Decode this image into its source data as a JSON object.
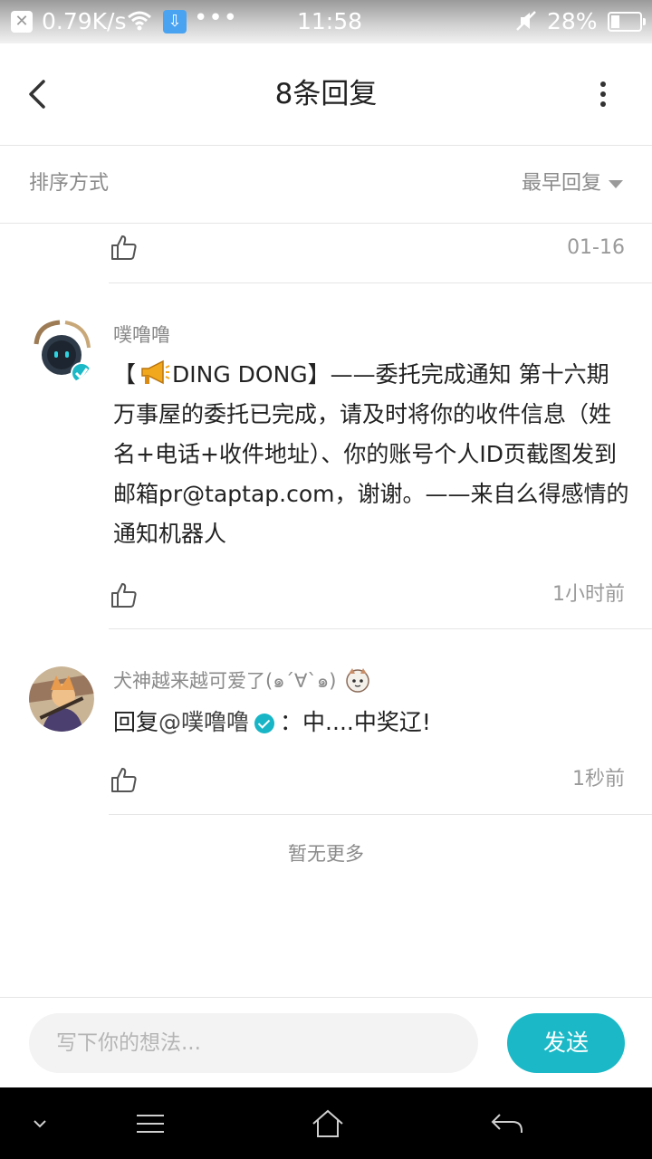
{
  "status_bar": {
    "network_speed": "0.79K/s",
    "time": "11:58",
    "battery": "28%",
    "icons": [
      "close-notification-icon",
      "wifi-icon",
      "app-download-icon",
      "more-notifications-icon",
      "mute-icon",
      "battery-icon"
    ]
  },
  "header": {
    "title": "8条回复",
    "back_icon": "back-arrow-icon",
    "menu_icon": "more-vertical-icon"
  },
  "sort": {
    "label": "排序方式",
    "selected": "最早回复"
  },
  "replies": [
    {
      "time": "01-16"
    },
    {
      "username": "噗噜噜",
      "verified": true,
      "body_prefix": "【",
      "body_icon": "megaphone-icon",
      "body": "DING DONG】——委托完成通知 第十六期万事屋的委托已完成，请及时将你的收件信息（姓名+电话+收件地址）、你的账号个人ID页截图发到邮箱pr@taptap.com，谢谢。——来自么得感情的通知机器人",
      "time": "1小时前"
    },
    {
      "username": "犬神越来越可爱了(๑´∀`๑)",
      "reply_prefix": "回复",
      "mention": "@噗噜噜",
      "separator": "：",
      "body": "中....中奖辽!",
      "time": "1秒前"
    }
  ],
  "footer_text": "暂无更多",
  "composer": {
    "placeholder": "写下你的想法...",
    "send_label": "发送"
  },
  "colors": {
    "accent": "#1bb9c7",
    "muted_text": "#8a8a8a",
    "divider": "#e5e5e5"
  }
}
